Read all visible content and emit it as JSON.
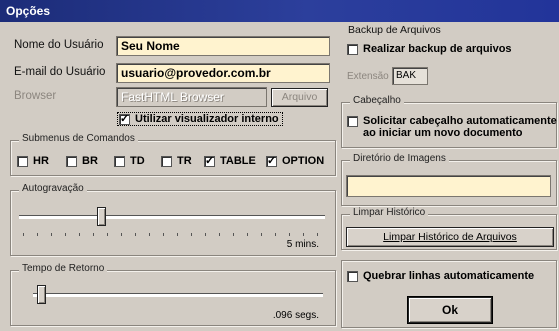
{
  "window": {
    "title": "Opções"
  },
  "user": {
    "name_label": "Nome do Usuário",
    "name_value": "Seu Nome",
    "email_label": "E-mail do Usuário",
    "email_value": "usuario@provedor.com.br",
    "browser_label": "Browser",
    "browser_value": "FastHTML Browser",
    "browse_button": "Arquivo",
    "internal_viewer_label": "Utilizar visualizador interno",
    "internal_viewer_checked": true
  },
  "submenus": {
    "title": "Submenus de Comandos",
    "items": [
      {
        "label": "HR",
        "checked": false
      },
      {
        "label": "BR",
        "checked": false
      },
      {
        "label": "TD",
        "checked": false
      },
      {
        "label": "TR",
        "checked": false
      },
      {
        "label": "TABLE",
        "checked": true
      },
      {
        "label": "OPTION",
        "checked": true
      }
    ]
  },
  "autosave": {
    "title": "Autogravação",
    "value_text": "5 mins.",
    "level": 0.27
  },
  "return_time": {
    "title": "Tempo de Retorno",
    "value_text": ".096 segs.",
    "level": 0.02
  },
  "backup": {
    "title": "Backup de Arquivos",
    "checkbox_label": "Realizar backup de arquivos",
    "checked": false,
    "ext_label": "Extensão",
    "ext_value": "BAK"
  },
  "header": {
    "title": "Cabeçalho",
    "checkbox_line1": "Solicitar cabeçalho automaticamente",
    "checkbox_line2": "ao iniciar um novo documento",
    "checked": false
  },
  "images_dir": {
    "title": "Diretório de Imagens",
    "value": ""
  },
  "history": {
    "title": "Limpar Histórico",
    "button_label": "Limpar Histórico de Arquivos"
  },
  "wrap": {
    "label": "Quebrar linhas automaticamente",
    "checked": false
  },
  "ok_button": "Ok"
}
